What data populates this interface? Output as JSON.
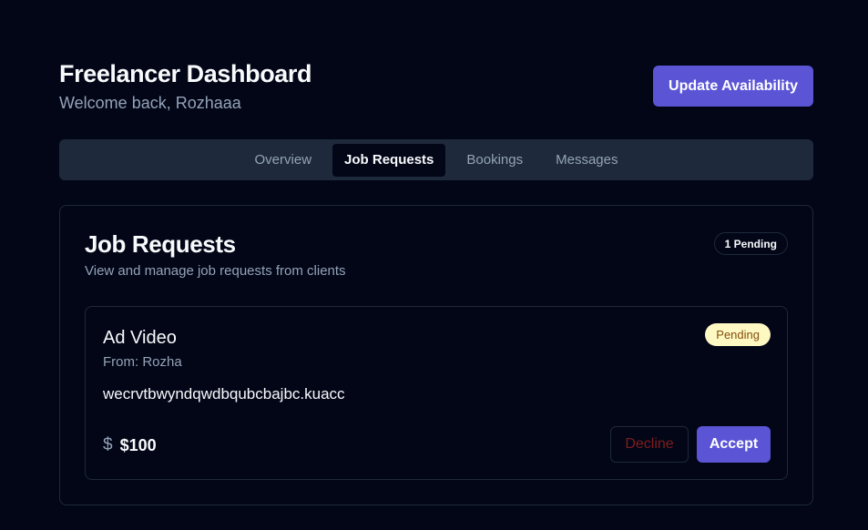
{
  "header": {
    "title": "Freelancer Dashboard",
    "subtitle": "Welcome back, Rozhaaa",
    "update_button": "Update Availability"
  },
  "tabs": [
    {
      "label": "Overview",
      "active": false
    },
    {
      "label": "Job Requests",
      "active": true
    },
    {
      "label": "Bookings",
      "active": false
    },
    {
      "label": "Messages",
      "active": false
    }
  ],
  "card": {
    "title": "Job Requests",
    "description": "View and manage job requests from clients",
    "pending_count": "1 Pending"
  },
  "jobs": [
    {
      "title": "Ad Video",
      "from": "From: Rozha",
      "description": "wecrvtbwyndqwdbqubcbajbc.kuacc",
      "status": "Pending",
      "currency_icon": "$",
      "price": "$100",
      "decline_label": "Decline",
      "accept_label": "Accept"
    }
  ],
  "colors": {
    "background": "#020617",
    "primary": "#5b55d6",
    "border": "#1e293b",
    "muted_text": "#94a3b8",
    "pending_badge_bg": "#fef9c3",
    "pending_badge_text": "#854d0e",
    "decline_text": "#7f1d1d"
  }
}
